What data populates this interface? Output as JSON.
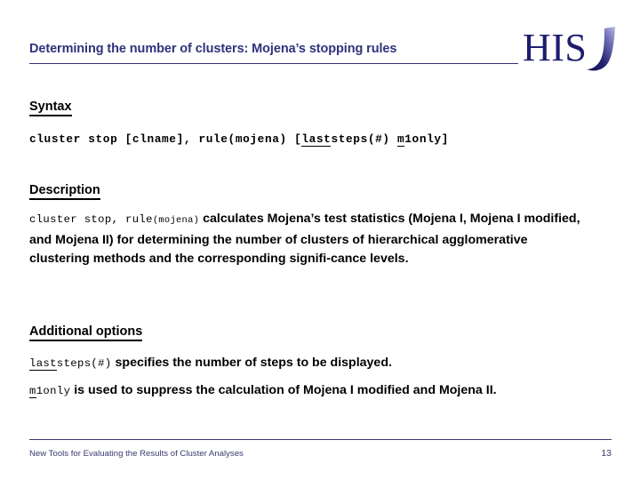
{
  "slide": {
    "title": "Determining the number of clusters: Mojena’s stopping rules",
    "title_color": "#32327d",
    "background": "#ffffff"
  },
  "logo": {
    "text": "HIS",
    "swoosh_icon": "his-swoosh-icon",
    "color": "#1d1d6e",
    "swoosh_light": "#9d9dd6"
  },
  "syntax": {
    "heading": "Syntax",
    "command": "cluster stop [clname], rule(mojena) ",
    "bracket_open": "[",
    "opt1_underlined": "last",
    "opt1_rest": "steps(#) ",
    "opt2_underlined": "m",
    "opt2_rest": "1only",
    "bracket_close": "]"
  },
  "description": {
    "heading": "Description",
    "code_part": "cluster stop, ",
    "code_rule": "rule",
    "code_arg": "(mojena)",
    "body": " calculates Mojena’s test statistics (Mojena I, Mojena I modified, and Mojena II) for determining the number of clusters of hierarchical agglomerative clustering methods and the corresponding signifi-cance levels."
  },
  "additional_options": {
    "heading": "Additional options",
    "options": [
      {
        "code_underlined": "last",
        "code_rest": "steps(#)",
        "text": " specifies the number of steps to be displayed."
      },
      {
        "code_underlined": "m",
        "code_rest": "1only",
        "text": " is used to suppress the calculation of Mojena I modified and Mojena II."
      }
    ]
  },
  "footer": {
    "text": "New Tools for Evaluating the Results of Cluster Analyses",
    "page": "13",
    "color": "#3a3a72"
  }
}
